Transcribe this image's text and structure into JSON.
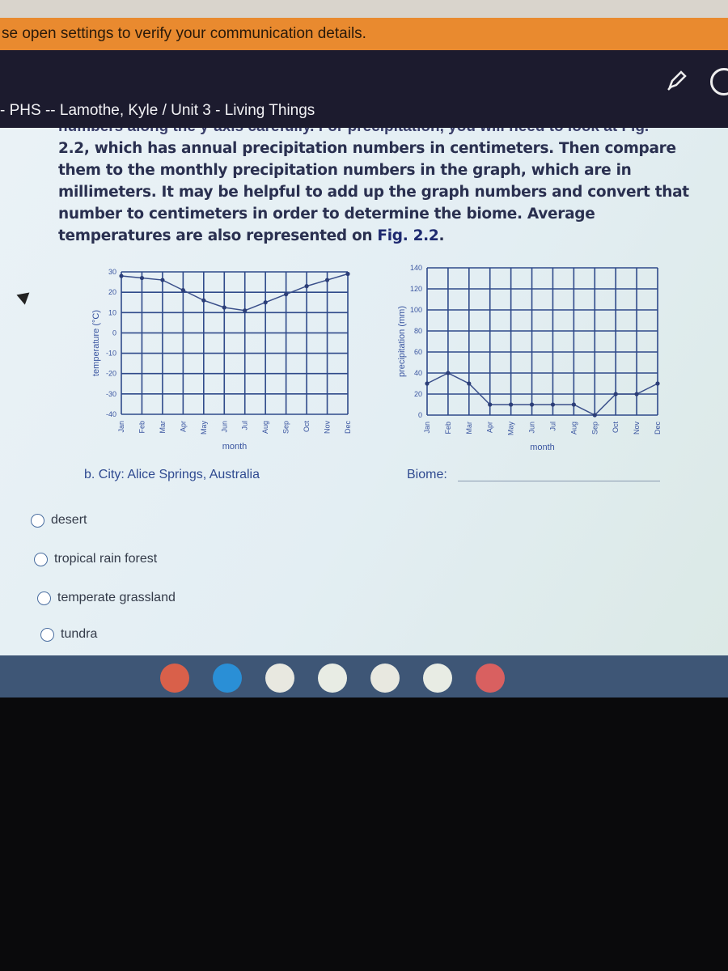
{
  "banner": {
    "text": "se open settings to verify your communication details."
  },
  "header": {
    "breadcrumb": "- PHS -- Lamothe, Kyle / Unit 3 - Living Things",
    "icons": [
      "pen-icon",
      "block-icon"
    ]
  },
  "question": {
    "cut_line": "numbers along the y-axis carefully. For precipitation, you will need to look at Fig.",
    "text_before": "2.2, which has annual precipitation numbers in centimeters. Then compare them to the monthly precipitation numbers in the graph, which are in millimeters. It may be helpful to add up the graph numbers and convert that number to centimeters in order to determine the biome. Average temperatures are also represented on ",
    "fig_ref": "Fig. 2.2",
    "text_after": ".",
    "city": "b. City: Alice Springs, Australia",
    "biome_label": "Biome:",
    "options": [
      "desert",
      "tropical rain forest",
      "temperate grassland",
      "tundra"
    ]
  },
  "chart_data": [
    {
      "type": "line",
      "xlabel": "month",
      "ylabel": "temperature (°C)",
      "ylim": [
        -40,
        30
      ],
      "yticks": [
        30,
        20,
        10,
        0,
        -10,
        -20,
        -30,
        -40
      ],
      "grid": true,
      "categories": [
        "Jan",
        "Feb",
        "Mar",
        "Apr",
        "May",
        "Jun",
        "Jul",
        "Aug",
        "Sep",
        "Oct",
        "Nov",
        "Dec"
      ],
      "values": [
        28,
        27,
        26,
        21,
        16,
        12.5,
        11,
        15,
        19,
        23,
        26,
        29
      ]
    },
    {
      "type": "line",
      "xlabel": "month",
      "ylabel": "precipitation (mm)",
      "ylim": [
        0,
        140
      ],
      "yticks": [
        140,
        120,
        100,
        80,
        60,
        40,
        20,
        0
      ],
      "grid": true,
      "categories": [
        "Jan",
        "Feb",
        "Mar",
        "Apr",
        "May",
        "Jun",
        "Jul",
        "Aug",
        "Sep",
        "Oct",
        "Nov",
        "Dec"
      ],
      "values": [
        30,
        40,
        30,
        10,
        10,
        10,
        10,
        10,
        0,
        20,
        20,
        30
      ]
    }
  ],
  "taskbar": {
    "apps": [
      {
        "name": "chrome-icon",
        "color": "#d9604a"
      },
      {
        "name": "files-icon",
        "color": "#2a8fd6"
      },
      {
        "name": "gmail-icon",
        "color": "#e8e8e0"
      },
      {
        "name": "docs-icon",
        "color": "#e8ece4"
      },
      {
        "name": "youtube-icon",
        "color": "#e8e8e0"
      },
      {
        "name": "play-store-icon",
        "color": "#e8ece4"
      },
      {
        "name": "gallery-icon",
        "color": "#d96060"
      }
    ]
  }
}
